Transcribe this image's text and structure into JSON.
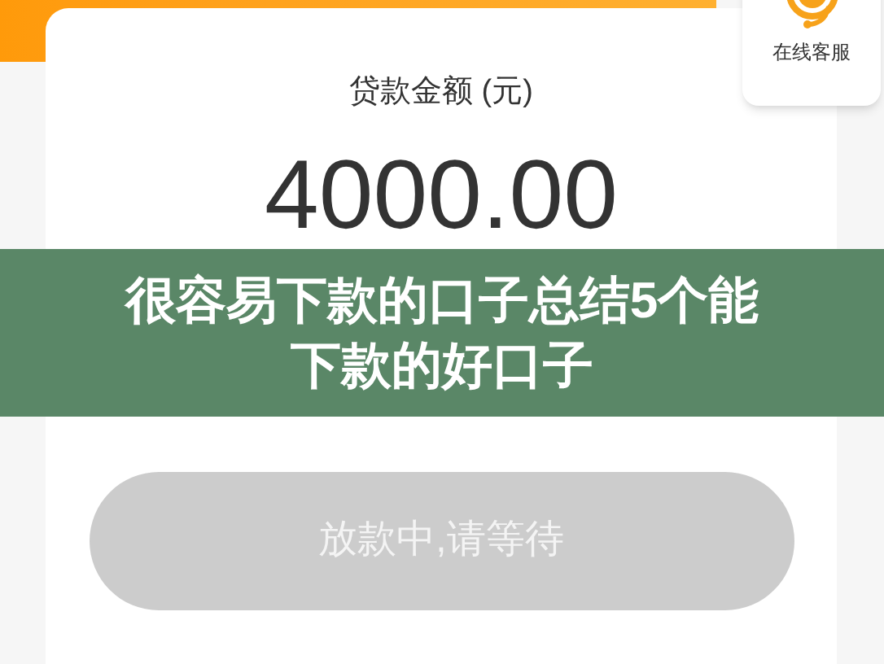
{
  "service": {
    "label": "在线客服"
  },
  "loan": {
    "label": "贷款金额 (元)",
    "amount": "4000.00"
  },
  "submit_button": {
    "label": "放款中,请等待",
    "disabled": true
  },
  "banner": {
    "title": "很容易下款的口子总结5个能下款的好口子"
  }
}
